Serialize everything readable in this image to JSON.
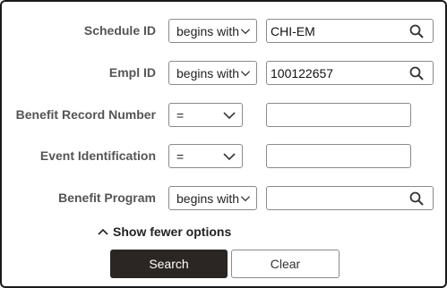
{
  "fields": [
    {
      "label": "Schedule ID",
      "operator": "begins with",
      "value": "CHI-EM",
      "has_lookup": true
    },
    {
      "label": "Empl ID",
      "operator": "begins with",
      "value": "100122657",
      "has_lookup": true
    },
    {
      "label": "Benefit Record Number",
      "operator": "=",
      "value": "",
      "has_lookup": false
    },
    {
      "label": "Event Identification",
      "operator": "=",
      "value": "",
      "has_lookup": false
    },
    {
      "label": "Benefit Program",
      "operator": "begins with",
      "value": "",
      "has_lookup": true
    }
  ],
  "toggle_label": "Show fewer options",
  "buttons": {
    "search": "Search",
    "clear": "Clear"
  },
  "icons": {
    "lookup": "search-icon",
    "operator_dropdown": "chevron-down-icon",
    "toggle": "chevron-up-icon"
  },
  "colors": {
    "primary_button": "#2b2623",
    "label_text": "#555555",
    "border": "#8a8a8a"
  }
}
